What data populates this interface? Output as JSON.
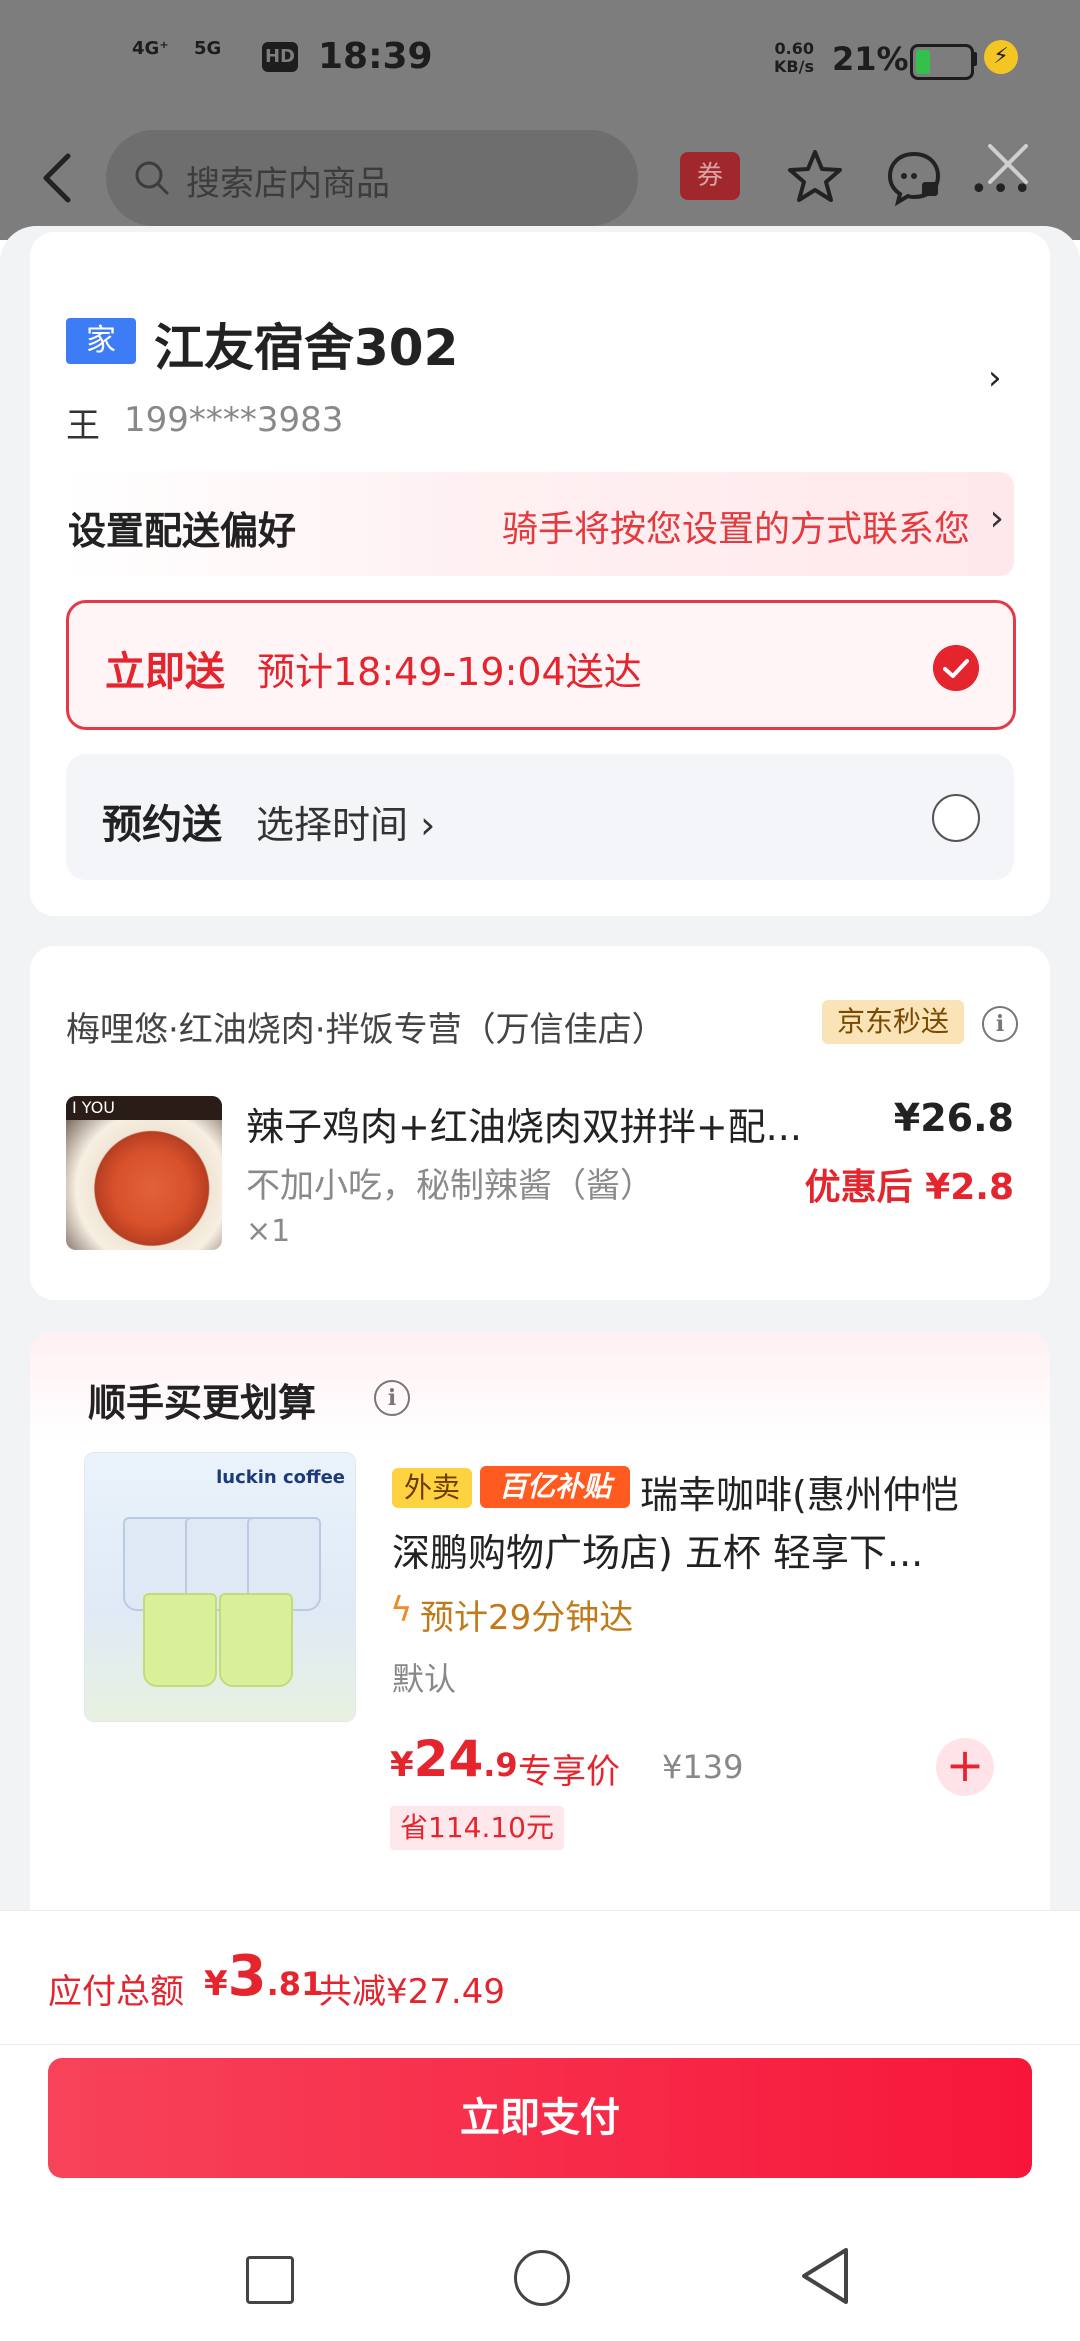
{
  "status_bar": {
    "time": "18:39",
    "signal1": "4G⁺",
    "signal2": "5G",
    "hd": "HD",
    "speed_value": "0.60",
    "speed_unit": "KB/s",
    "battery": "21%"
  },
  "topbar": {
    "search_placeholder": "搜索店内商品",
    "coupon_label": "券",
    "more_label": "•••"
  },
  "address": {
    "tag": "家",
    "title": "江友宿舍302",
    "name": "王",
    "phone": "199****3983",
    "chevron": "›"
  },
  "delivery_pref": {
    "label": "设置配送偏好",
    "hint": "骑手将按您设置的方式联系您",
    "chevron": "›"
  },
  "delivery_options": {
    "now": {
      "label": "立即送",
      "time": "预计18:49-19:04送达",
      "selected": true
    },
    "later": {
      "label": "预约送",
      "time": "选择时间 ›",
      "selected": false
    }
  },
  "order": {
    "store": "梅哩悠·红油烧肉·拌饭专营（万信佳店）",
    "badge": "京东秒送",
    "info": "i",
    "image_caption": "I YOU",
    "item_name": "辣子鸡肉+红油烧肉双拼拌+配...",
    "item_price": "¥26.8",
    "item_spec": "不加小吃，秘制辣酱（酱）",
    "item_discount": "优惠后 ¥2.8",
    "item_qty": "×1"
  },
  "recommendation": {
    "title": "顺手买更划算",
    "info": "i",
    "brand": "luckin coffee",
    "tag_waimai": "外卖",
    "tag_yibu": "百亿补贴",
    "name_line1": "瑞幸咖啡(惠州仲恺",
    "name_line2": "深鹏购物广场店) 五杯 轻享下...",
    "eta": "预计29分钟达",
    "spec": "默认",
    "price_currency": "¥",
    "price_int": "24",
    "price_dec": ".9",
    "price_label": "专享价",
    "original_price": "¥139",
    "save": "省114.10元",
    "add": "+"
  },
  "footer": {
    "total_label": "应付总额",
    "total_currency": "¥",
    "total_int": "3",
    "total_dec": ".81",
    "total_reduce": "共减¥27.49",
    "pay_button": "立即支付"
  },
  "colors": {
    "accent": "#e4252e",
    "home_tag": "#3d7cf4",
    "pay_gradient_start": "#f7435a",
    "pay_gradient_end": "#f7163a"
  }
}
